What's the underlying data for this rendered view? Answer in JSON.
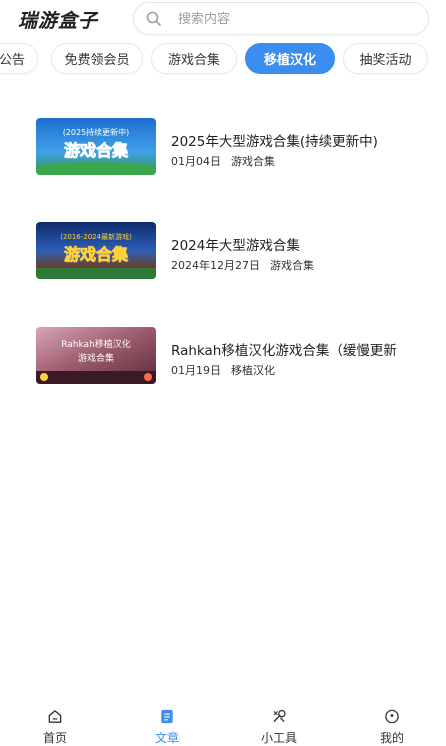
{
  "header": {
    "app_title": "瑞游盒子"
  },
  "search": {
    "placeholder": "搜索内容",
    "icon": "search-icon"
  },
  "tabs": [
    {
      "label": "公告",
      "active": false
    },
    {
      "label": "免费领会员",
      "active": false
    },
    {
      "label": "游戏合集",
      "active": false
    },
    {
      "label": "移植汉化",
      "active": true
    },
    {
      "label": "抽奖活动",
      "active": false
    }
  ],
  "articles": [
    {
      "title": "2025年大型游戏合集(持续更新中)",
      "date": "01月04日",
      "category": "游戏合集",
      "thumb": {
        "top_text": "(2025持续更新中)",
        "main_text": "游戏合集"
      }
    },
    {
      "title": "2024年大型游戏合集",
      "date": "2024年12月27日",
      "category": "游戏合集",
      "thumb": {
        "top_text": "(2016-2024最新游戏)",
        "main_text": "游戏合集"
      }
    },
    {
      "title": "Rahkah移植汉化游戏合集（缓慢更新",
      "date": "01月19日",
      "category": "移植汉化",
      "thumb": {
        "top_text": "Rahkah移植汉化",
        "main_text": "游戏合集"
      }
    }
  ],
  "bottom_nav": [
    {
      "label": "首页",
      "icon": "home-icon",
      "active": false
    },
    {
      "label": "文章",
      "icon": "article-icon",
      "active": true
    },
    {
      "label": "小工具",
      "icon": "tools-icon",
      "active": false
    },
    {
      "label": "我的",
      "icon": "profile-icon",
      "active": false
    }
  ],
  "colors": {
    "accent": "#3b8df0",
    "text": "#222222",
    "border": "#e8e9ec"
  }
}
